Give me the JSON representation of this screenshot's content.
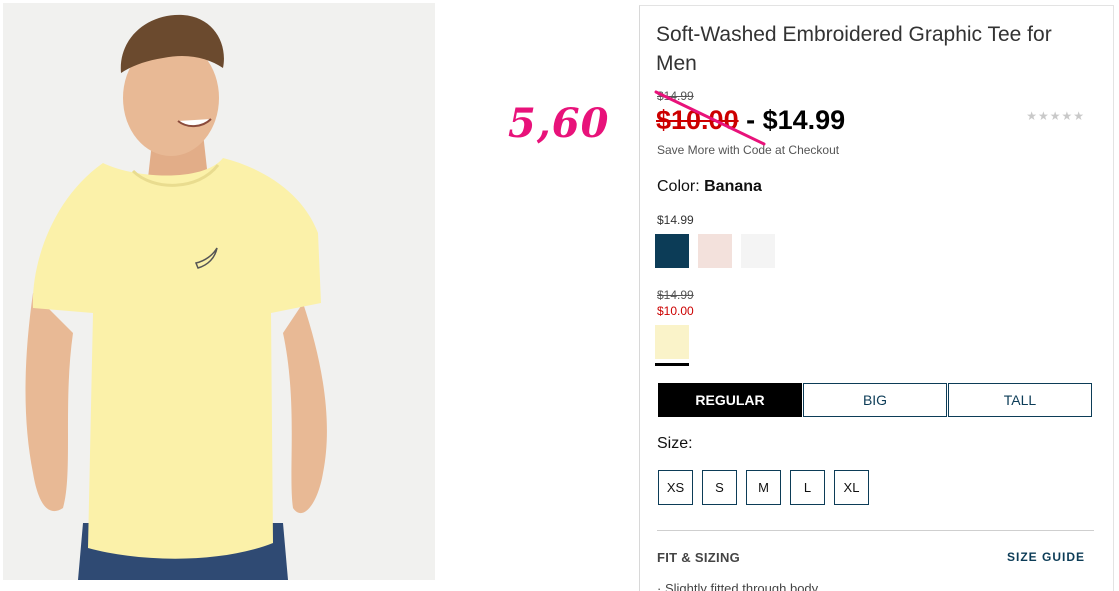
{
  "annotation": {
    "text": "5,60"
  },
  "product": {
    "title": "Soft-Washed Embroidered Graphic Tee for Men",
    "price_original": "$14.99",
    "price_sale": "$10.00",
    "price_separator": " - ",
    "price_regular": "$14.99",
    "rating_stars": "★★★★★",
    "promo_text": "Save More with Code at Checkout"
  },
  "color": {
    "label": "Color: ",
    "selected": "Banana",
    "group1_price": "$14.99",
    "group2_price_original": "$14.99",
    "group2_price_sale": "$10.00",
    "swatch_colors": [
      "#0c3c57",
      "#f3e1dc",
      "#f4f4f4",
      "#faf3c9"
    ]
  },
  "fit": {
    "tabs": [
      "REGULAR",
      "BIG",
      "TALL"
    ],
    "active": "REGULAR"
  },
  "size": {
    "label": "Size:",
    "options": [
      "XS",
      "S",
      "M",
      "L",
      "XL"
    ]
  },
  "details": {
    "fit_heading": "FIT & SIZING",
    "size_guide": "SIZE GUIDE",
    "bullet": "· Slightly fitted through body"
  },
  "colors": {
    "accent_navy": "#0c3c57",
    "sale_red": "#cc0000",
    "annotation_pink": "#e8127a"
  }
}
